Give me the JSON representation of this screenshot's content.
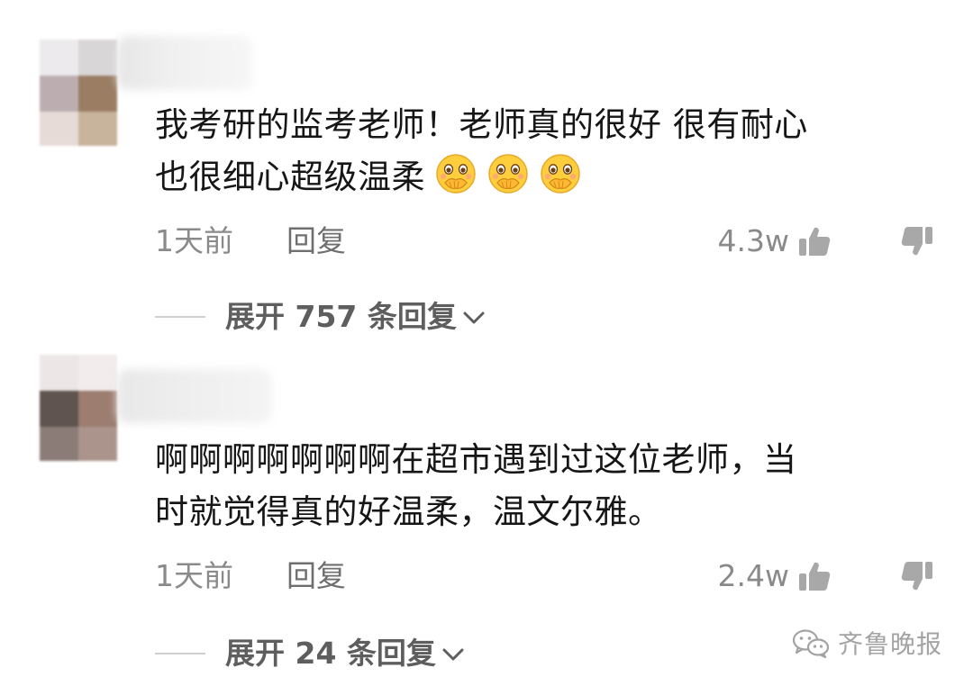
{
  "comments": [
    {
      "text_lines": [
        "我考研的监考老师！老师真的很好 很有耐心",
        "也很细心超级温柔"
      ],
      "emoji": "shy-hand-over-mouth-emoji",
      "emoji_count": 3,
      "time": "1天前",
      "reply_label": "回复",
      "like_count": "4.3w",
      "expand_label": "展开 757 条回复"
    },
    {
      "text_lines": [
        "啊啊啊啊啊啊啊在超市遇到过这位老师，当",
        "时就觉得真的好温柔，温文尔雅。"
      ],
      "time": "1天前",
      "reply_label": "回复",
      "like_count": "2.4w",
      "expand_label": "展开 24 条回复"
    }
  ],
  "icons": {
    "like": "thumbs-up-icon",
    "dislike": "thumbs-down-icon",
    "expand": "chevron-down-icon",
    "watermark": "wechat-icon"
  },
  "watermark": {
    "text": "齐鲁晚报"
  },
  "colors": {
    "text": "#161616",
    "meta": "#8a8a8a",
    "icon": "#a8a8a8",
    "emoji_face": "#ffce3d"
  }
}
